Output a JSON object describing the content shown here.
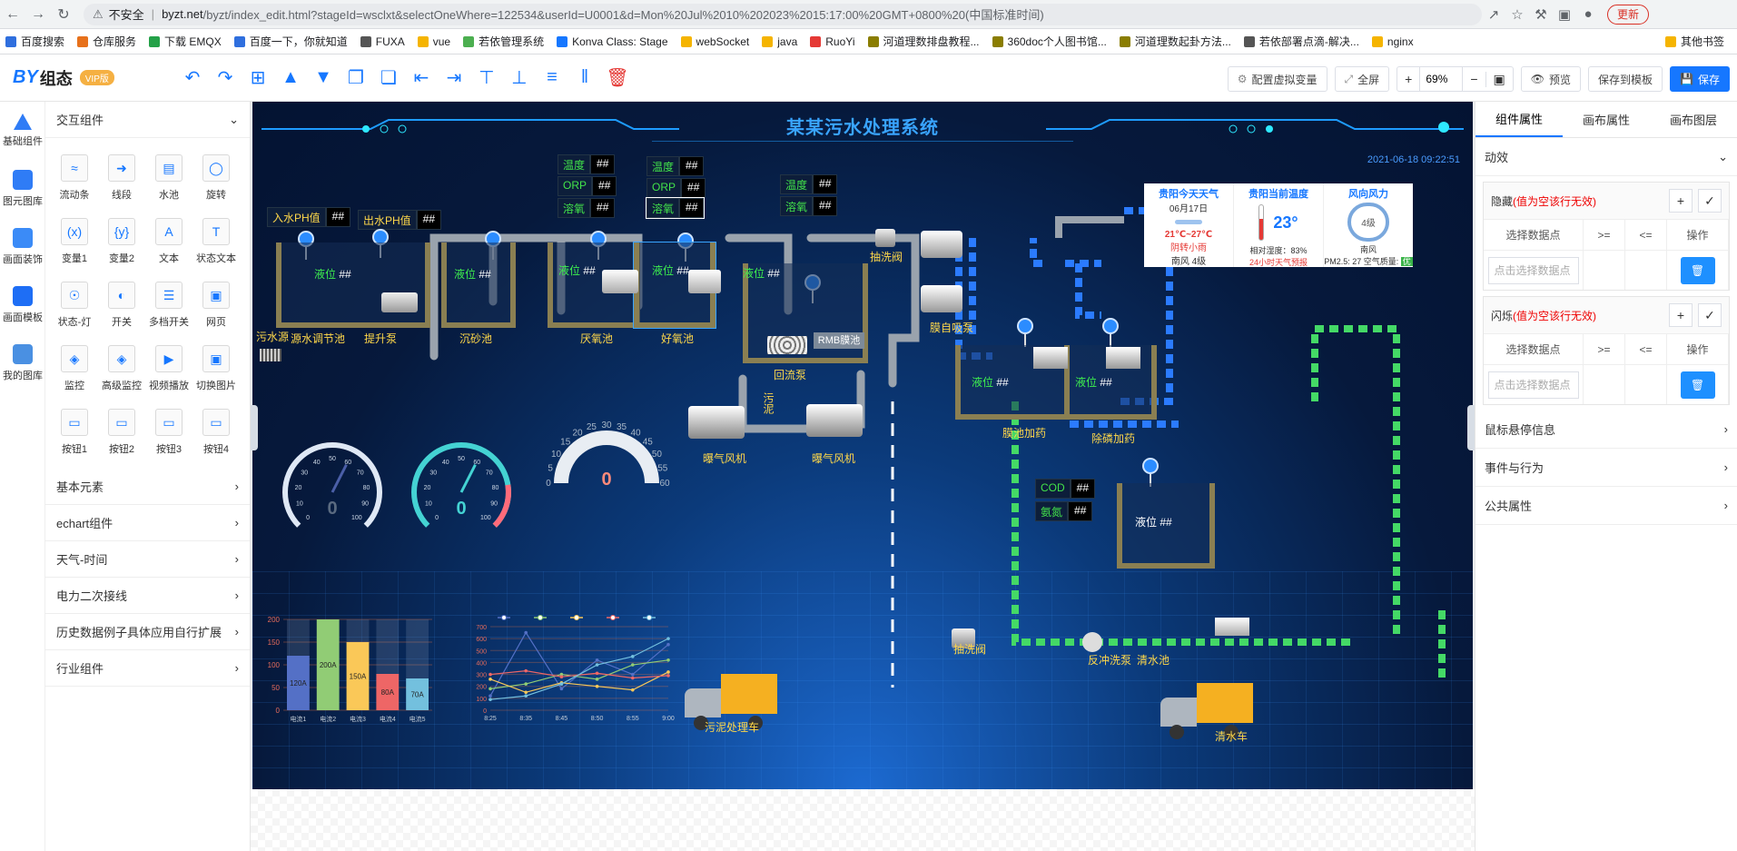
{
  "browser": {
    "insecure": "不安全",
    "url_host": "byzt.net",
    "url_path": "/byzt/index_edit.html?stageId=wsclxt&selectOneWhere=122534&userId=U0001&d=Mon%20Jul%2010%202023%2015:17:00%20GMT+0800%20(中国标准时间)",
    "update": "更新"
  },
  "bookmarks": [
    "百度搜索",
    "仓库服务",
    "下载 EMQX",
    "百度一下，你就知道",
    "FUXA",
    "vue",
    "若依管理系统",
    "Konva Class: Stage",
    "webSocket",
    "java",
    "RuoYi",
    "河道理数排盘教程...",
    "360doc个人图书馆...",
    "河道理数起卦方法...",
    "若依部署点滴-解决...",
    "nginx",
    "其他书签"
  ],
  "app": {
    "logo_by": "BY",
    "logo_zt": "组态",
    "vip": "VIP版",
    "btn_vars": "配置虚拟变量",
    "btn_full": "全屏",
    "zoom": "69%",
    "btn_preview": "预览",
    "btn_save_tpl": "保存到模板",
    "btn_save": "保存"
  },
  "rail": [
    "基础组件",
    "图元图库",
    "画面装饰",
    "画面模板",
    "我的图库"
  ],
  "left_panel": {
    "section_interactive": "交互组件",
    "components": [
      "流动条",
      "线段",
      "水池",
      "旋转",
      "变量1",
      "变量2",
      "文本",
      "状态文本",
      "状态-灯",
      "开关",
      "多档开关",
      "网页",
      "监控",
      "高级监控",
      "视频播放",
      "切换图片",
      "按钮1",
      "按钮2",
      "按钮3",
      "按钮4"
    ],
    "sections": [
      "基本元素",
      "echart组件",
      "天气-时间",
      "电力二次接线",
      "历史数据例子具体应用自行扩展",
      "行业组件"
    ]
  },
  "right_panel": {
    "tabs": [
      "组件属性",
      "画布属性",
      "画布图层"
    ],
    "anim": "动效",
    "hide_title": "隐藏",
    "hide_note": "(值为空该行无效)",
    "flash_title": "闪烁",
    "flash_note": "(值为空该行无效)",
    "col_point": "选择数据点",
    "col_ge": ">=",
    "col_le": "<=",
    "col_op": "操作",
    "placeholder": "点击选择数据点",
    "sections": [
      "鼠标悬停信息",
      "事件与行为",
      "公共属性"
    ]
  },
  "scada": {
    "title": "某某污水处理系统",
    "datetime": "2021-06-18 09:22:51",
    "tags": {
      "in_ph": "入水PH值",
      "out_ph": "出水PH值",
      "temp": "温度",
      "orp": "ORP",
      "do": "溶氧",
      "cod": "COD",
      "nh3": "氨氮",
      "val": "##"
    },
    "level": "液位",
    "labels": {
      "sewage_src": "污水源",
      "t1": "源水调节池",
      "pump1": "提升泵",
      "t2": "沉砂池",
      "t3": "厌氧池",
      "t4": "好氧池",
      "return_pump": "回流泵",
      "mbr": "RMB膜池",
      "suction1": "抽洗阀",
      "membrane_pump": "膜自吸泵",
      "blower1": "曝气风机",
      "blower2": "曝气风机",
      "sludge": "污泥",
      "t5": "膜池加药",
      "t6": "除磷加药",
      "suction2": "抽洗阀",
      "backwash": "反冲洗泵",
      "clear": "清水池",
      "sludge_truck": "污泥处理车",
      "clear_truck": "清水车"
    },
    "weather": {
      "today_title": "贵阳今天天气",
      "date": "06月17日",
      "temp_range": "21℃~27℃",
      "cond": "阴转小雨",
      "wind": "南风 4级",
      "now_title": "贵阳当前温度",
      "now_temp": "23°",
      "humidity": "相对湿度：83%",
      "forecast": "24小时天气预报",
      "wind_title": "风向风力",
      "wind_level": "4级",
      "wind_dir": "南风",
      "pm": "PM2.5:  27  空气质量:",
      "aq": "优"
    },
    "gauges": [
      {
        "value": "0",
        "ticks": [
          "0",
          "10",
          "20",
          "30",
          "40",
          "50",
          "60",
          "70",
          "80",
          "90",
          "100"
        ]
      },
      {
        "value": "0",
        "ticks": [
          "0",
          "10",
          "20",
          "30",
          "40",
          "50",
          "60",
          "70",
          "80",
          "90",
          "100"
        ]
      },
      {
        "value": "0",
        "ticks": [
          "0",
          "5",
          "10",
          "15",
          "20",
          "25",
          "30",
          "35",
          "40",
          "45",
          "50",
          "55",
          "60"
        ]
      }
    ]
  },
  "chart_data": [
    {
      "type": "bar",
      "categories": [
        "电流1",
        "电流2",
        "电流3",
        "电流4",
        "电流5"
      ],
      "values": [
        120,
        200,
        150,
        80,
        70
      ],
      "labels": [
        "120A",
        "200A",
        "150A",
        "80A",
        "70A"
      ],
      "colors": [
        "#5470c6",
        "#91cc75",
        "#fac858",
        "#ee6666",
        "#73c0de"
      ],
      "ylim": [
        0,
        200
      ],
      "yticks": [
        "0",
        "50",
        "100",
        "150",
        "200"
      ]
    },
    {
      "type": "line",
      "x": [
        "8:25",
        "8:35",
        "8:45",
        "8:50",
        "8:55",
        "9:00"
      ],
      "ylim": [
        0,
        700
      ],
      "yticks": [
        "0",
        "100",
        "200",
        "300",
        "400",
        "500",
        "600",
        "700"
      ],
      "series": [
        {
          "color": "#5470c6",
          "values": [
            120,
            650,
            180,
            420,
            300,
            550
          ]
        },
        {
          "color": "#91cc75",
          "values": [
            180,
            220,
            300,
            260,
            380,
            420
          ]
        },
        {
          "color": "#fac858",
          "values": [
            260,
            150,
            230,
            200,
            170,
            320
          ]
        },
        {
          "color": "#ee6666",
          "values": [
            300,
            330,
            280,
            310,
            270,
            290
          ]
        },
        {
          "color": "#73c0de",
          "values": [
            90,
            120,
            220,
            380,
            450,
            600
          ]
        }
      ]
    }
  ]
}
